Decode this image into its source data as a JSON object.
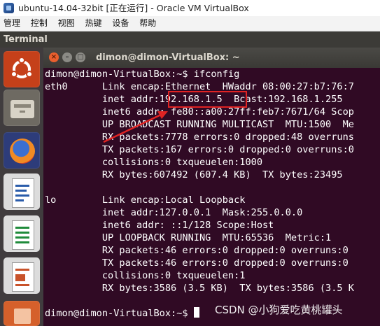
{
  "host_window": {
    "title": "ubuntu-14.04-32bit [正在运行] - Oracle VM VirtualBox",
    "menu": [
      "管理",
      "控制",
      "视图",
      "热键",
      "设备",
      "帮助"
    ]
  },
  "guest": {
    "top_panel_title": "Terminal",
    "launcher_items": [
      {
        "name": "ubuntu-dash-icon"
      },
      {
        "name": "files-icon"
      },
      {
        "name": "firefox-icon"
      },
      {
        "name": "libreoffice-writer-icon"
      },
      {
        "name": "libreoffice-calc-icon"
      },
      {
        "name": "libreoffice-impress-icon"
      },
      {
        "name": "ubuntu-software-icon"
      }
    ]
  },
  "terminal": {
    "window_title": "dimon@dimon-VirtualBox: ~",
    "lines": [
      "dimon@dimon-VirtualBox:~$ ifconfig",
      "eth0      Link encap:Ethernet  HWaddr 08:00:27:b7:76:7",
      "          inet addr:192.168.1.5  Bcast:192.168.1.255",
      "          inet6 addr: fe80::a00:27ff:feb7:7671/64 Scop",
      "          UP BROADCAST RUNNING MULTICAST  MTU:1500  Me",
      "          RX packets:7778 errors:0 dropped:48 overruns",
      "          TX packets:167 errors:0 dropped:0 overruns:0",
      "          collisions:0 txqueuelen:1000",
      "          RX bytes:607492 (607.4 KB)  TX bytes:23495",
      "",
      "lo        Link encap:Local Loopback",
      "          inet addr:127.0.0.1  Mask:255.0.0.0",
      "          inet6 addr: ::1/128 Scope:Host",
      "          UP LOOPBACK RUNNING  MTU:65536  Metric:1",
      "          RX packets:46 errors:0 dropped:0 overruns:0",
      "          TX packets:46 errors:0 dropped:0 overruns:0",
      "          collisions:0 txqueuelen:1",
      "          RX bytes:3586 (3.5 KB)  TX bytes:3586 (3.5 K",
      "",
      "dimon@dimon-VirtualBox:~$ "
    ],
    "colors": {
      "background": "#300a24",
      "text": "#ffffff",
      "highlight": "#e02323"
    }
  },
  "watermark": "CSDN @小狗爱吃黄桃罐头"
}
